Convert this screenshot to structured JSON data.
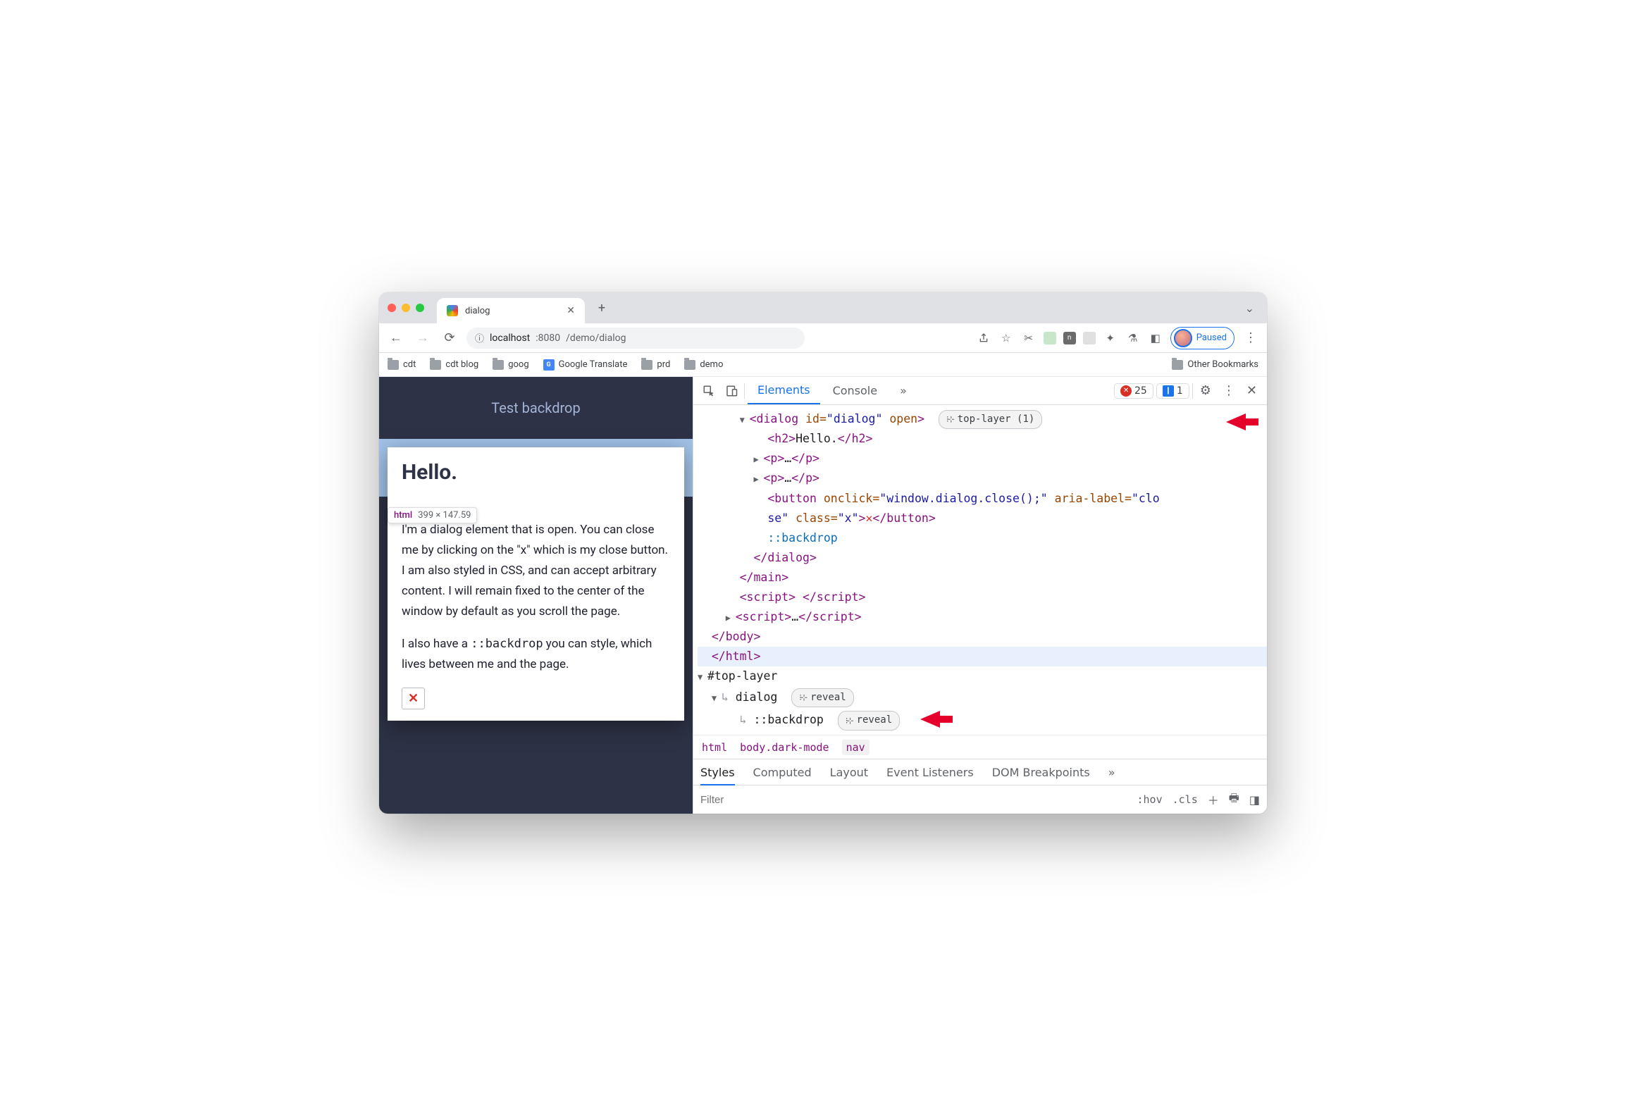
{
  "tab": {
    "title": "dialog"
  },
  "url": {
    "host": "localhost",
    "port": ":8080",
    "path": "/demo/dialog"
  },
  "profile": {
    "status": "Paused"
  },
  "bookmarks": {
    "items": [
      "cdt",
      "cdt blog",
      "goog",
      "Google Translate",
      "prd",
      "demo"
    ],
    "other": "Other Bookmarks"
  },
  "page": {
    "headerButton": "Test backdrop",
    "h2": "Hello.",
    "p1": "I'm a dialog element that is open. You can close me by clicking on the \"x\" which is my close button. I am also styled in CSS, and can accept arbitrary content. I will remain fixed to the center of the window by default as you scroll the page.",
    "p2a": "I also have a ",
    "p2code": "::backdrop",
    "p2b": " you can style, which lives between me and the page.",
    "tooltip": {
      "el": "html",
      "dim": "399 × 147.59"
    },
    "xmark": "✕"
  },
  "devtools": {
    "tabs": {
      "elements": "Elements",
      "console": "Console",
      "more": "»"
    },
    "errors": "25",
    "messages": "1",
    "dom": {
      "dialogOpen": "<dialog id=\"dialog\" open>",
      "topLayerBadge": "top-layer (1)",
      "h2open": "<h2>",
      "h2text": "Hello.",
      "h2close": "</h2>",
      "pCollapsed": "<p>…</p>",
      "buttonLine1a": "<button",
      "buttonOnclickAttr": " onclick=",
      "buttonOnclickVal": "\"window.dialog.close();\"",
      "buttonAriaAttr": " aria-label=",
      "buttonAriaVal": "\"clo",
      "buttonLine2a": "se\"",
      "buttonClassAttr": " class=",
      "buttonClassVal": "\"x\"",
      "buttonClose1": ">",
      "buttonX": "✕",
      "buttonClose2": "</button>",
      "backdropPseudo": "::backdrop",
      "dialogClose": "</dialog>",
      "mainClose": "</main>",
      "scriptEmpty": "<script> </script>",
      "scriptCollapsed": "<script>…</script>",
      "bodyClose": "</body>",
      "htmlClose": "</html>",
      "topLayer": "#top-layer",
      "tlDialog": "dialog",
      "tlBackdrop": "::backdrop",
      "reveal": "reveal"
    },
    "crumb": {
      "c1": "html",
      "c2": "body.dark-mode",
      "c3": "nav"
    },
    "stylesTabs": {
      "styles": "Styles",
      "computed": "Computed",
      "layout": "Layout",
      "listeners": "Event Listeners",
      "dom": "DOM Breakpoints",
      "more": "»"
    },
    "filter": {
      "placeholder": "Filter",
      "hov": ":hov",
      "cls": ".cls"
    }
  }
}
